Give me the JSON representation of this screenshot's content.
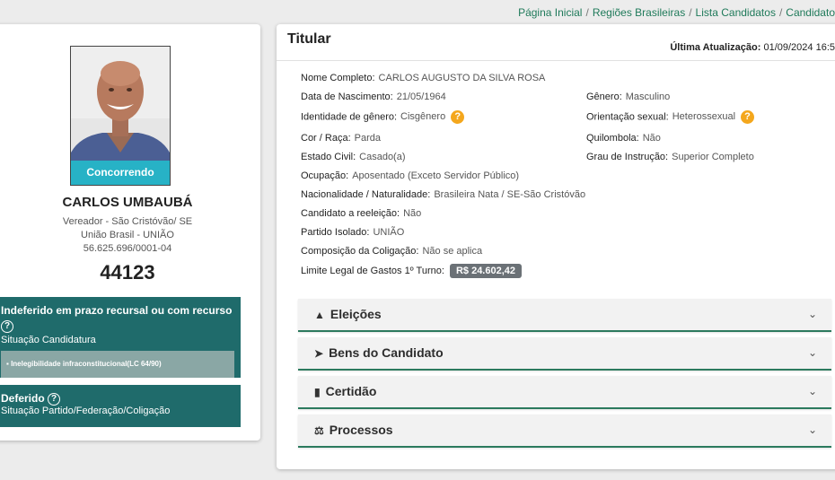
{
  "breadcrumb": [
    "Página Inicial",
    "Regiões Brasileiras",
    "Lista Candidatos",
    "Candidato"
  ],
  "profile": {
    "badge": "Concorrendo",
    "name": "CARLOS UMBAUBÁ",
    "office": "Vereador - São Cristóvão/ SE",
    "party": "União Brasil - UNIÃO",
    "cnpj": "56.625.696/0001-04",
    "number": "44123"
  },
  "status_candidacy": {
    "title": "Indeferido em prazo recursal ou com recurso",
    "subtitle": "Situação Candidatura",
    "item": "Inelegibilidade infraconstitucional(LC 64/90)"
  },
  "status_party": {
    "title": "Deferido",
    "subtitle": "Situação Partido/Federação/Coligação"
  },
  "main": {
    "title": "Titular",
    "last_update_label": "Última Atualização:",
    "last_update_value": "01/09/2024 16:5",
    "fields": {
      "full_name": {
        "label": "Nome Completo:",
        "value": "CARLOS AUGUSTO DA SILVA ROSA"
      },
      "birth_date": {
        "label": "Data de Nascimento:",
        "value": "21/05/1964"
      },
      "gender": {
        "label": "Gênero:",
        "value": "Masculino"
      },
      "gender_identity": {
        "label": "Identidade de gênero:",
        "value": "Cisgênero"
      },
      "sexual_orientation": {
        "label": "Orientação sexual:",
        "value": "Heterossexual"
      },
      "race": {
        "label": "Cor / Raça:",
        "value": "Parda"
      },
      "quilombola": {
        "label": "Quilombola:",
        "value": "Não"
      },
      "marital": {
        "label": "Estado Civil:",
        "value": "Casado(a)"
      },
      "education": {
        "label": "Grau de Instrução:",
        "value": "Superior Completo"
      },
      "occupation": {
        "label": "Ocupação:",
        "value": "Aposentado (Exceto Servidor Público)"
      },
      "nationality": {
        "label": "Nacionalidade / Naturalidade:",
        "value": "Brasileira Nata / SE-São Cristóvão"
      },
      "reelection": {
        "label": "Candidato a reeleição:",
        "value": "Não"
      },
      "isolated_party": {
        "label": "Partido Isolado:",
        "value": "UNIÃO"
      },
      "coalition": {
        "label": "Composição da Coligação:",
        "value": "Não se aplica"
      },
      "spending_limit": {
        "label": "Limite Legal de Gastos 1º Turno:",
        "value": "R$ 24.602,42"
      }
    },
    "help_icon": "?"
  },
  "accordions": [
    {
      "label": "Eleições",
      "icon": "sitemap-icon"
    },
    {
      "label": "Bens do Candidato",
      "icon": "rocket-icon"
    },
    {
      "label": "Certidão",
      "icon": "file-icon"
    },
    {
      "label": "Processos",
      "icon": "scale-icon"
    }
  ],
  "colors": {
    "brand_green": "#1f6b6b",
    "link_green": "#1f7a5a",
    "badge_blue": "#27b2c6",
    "help_orange": "#f4a71d"
  }
}
